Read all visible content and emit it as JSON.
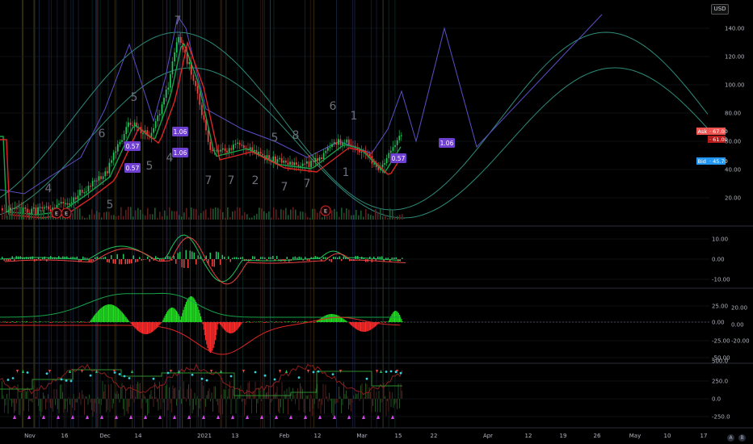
{
  "currency": "USD",
  "corner_buttons": [
    "A",
    "B"
  ],
  "price_panel": {
    "y_ticks": [
      "140.00",
      "120.00",
      "100.00",
      "80.00",
      "60.00",
      "40.00",
      "20.00"
    ],
    "ask_label": "Ask",
    "ask_value": "67.00",
    "mid_value": "61.00",
    "bid_label": "Bid",
    "bid_value": "45.70"
  },
  "macd_panel": {
    "y_ticks": [
      "10.00",
      "0.00",
      "-10.00"
    ]
  },
  "oscillator_panel": {
    "y_ticks": [
      "25.00",
      "0.00",
      "-25.00",
      "-50.00"
    ],
    "right_ticks": [
      "20.00",
      "0.00",
      "-20.00"
    ]
  },
  "bottom_panel": {
    "y_ticks": [
      "500.0",
      "250.0",
      "0.0",
      "-250.0"
    ]
  },
  "x_axis": [
    "Nov",
    "16",
    "Dec",
    "14",
    "2021",
    "13",
    "Feb",
    "12",
    "Mar",
    "15",
    "22",
    "Apr",
    "12",
    "19",
    "26",
    "May",
    "10",
    "17"
  ],
  "badges": [
    "0.57",
    "0.57",
    "1.06",
    "1.06",
    "1.06",
    "0.57"
  ],
  "wave_labels": [
    "4",
    "5",
    "6",
    "5",
    "7",
    "5",
    "4",
    "7",
    "7",
    "2",
    "5",
    "8",
    "7",
    "7",
    "6",
    "1",
    "1"
  ],
  "earnings_markers": [
    "E",
    "E",
    "E"
  ],
  "colors": {
    "up": "#22c55e",
    "down": "#ef4444",
    "teal": "#2e8b7a",
    "purple": "#5b4fc7",
    "badge": "#6e3fd1",
    "ask": "#ef5350",
    "bid": "#2196f3"
  },
  "chart_data": {
    "type": "line",
    "title": "",
    "x": [
      "Nov",
      "16",
      "Dec",
      "14",
      "2021",
      "13",
      "Feb",
      "12",
      "Mar",
      "15"
    ],
    "series": [
      {
        "values": [
          10,
          12,
          30,
          70,
          125,
          50,
          45,
          45,
          60,
          62
        ]
      }
    ],
    "ylim": [
      0,
      150
    ]
  }
}
